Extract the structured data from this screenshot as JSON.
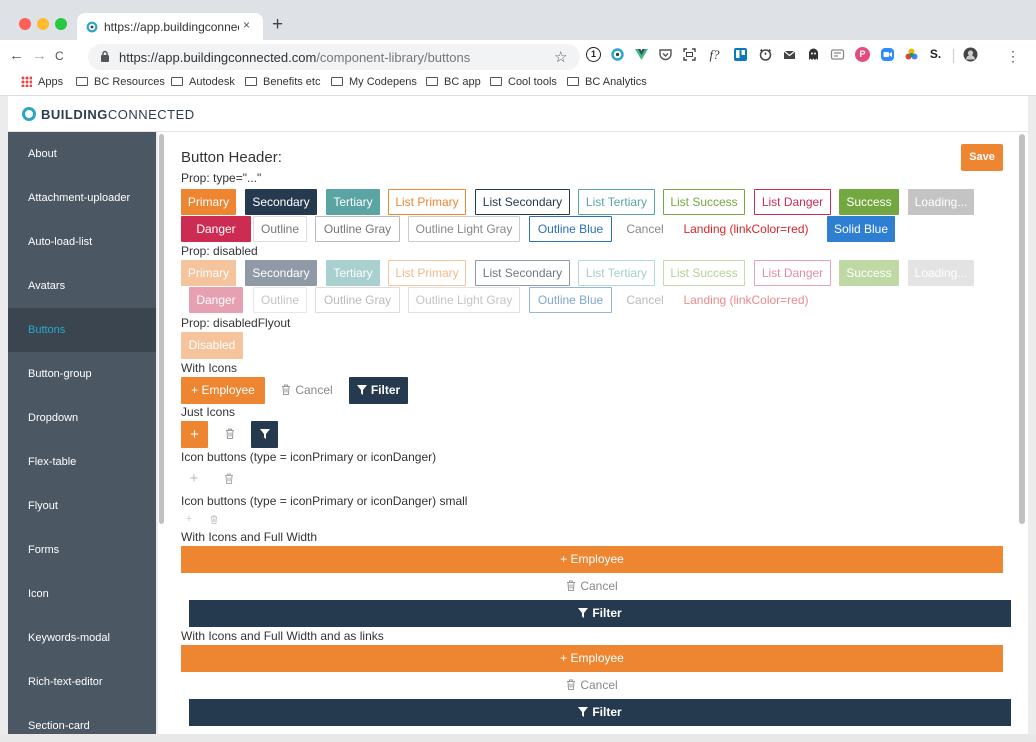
{
  "browser": {
    "tab_title": "https://app.buildingconnected",
    "tab_close": "×",
    "new_tab": "+",
    "back": "←",
    "forward": "→",
    "reload": "C",
    "url_scheme": "https://",
    "url_host": "app.buildingconnected.com",
    "url_path": "/component-library/buttons",
    "bookmarks": [
      "Apps",
      "BC Resources",
      "Autodesk",
      "Benefits etc",
      "My Codepens",
      "BC app",
      "Cool tools",
      "BC Analytics"
    ],
    "extension_profile_letter": "S."
  },
  "app": {
    "logo_bold": "BUILDING",
    "logo_light": "CONNECTED"
  },
  "sidebar": {
    "items": [
      {
        "label": "About"
      },
      {
        "label": "Attachment-uploader"
      },
      {
        "label": "Auto-load-list"
      },
      {
        "label": "Avatars"
      },
      {
        "label": "Buttons",
        "active": true
      },
      {
        "label": "Button-group"
      },
      {
        "label": "Dropdown"
      },
      {
        "label": "Flex-table"
      },
      {
        "label": "Flyout"
      },
      {
        "label": "Forms"
      },
      {
        "label": "Icon"
      },
      {
        "label": "Keywords-modal"
      },
      {
        "label": "Rich-text-editor"
      },
      {
        "label": "Section-card"
      }
    ]
  },
  "main": {
    "header": "Button Header:",
    "save": "Save",
    "prop_type": "Prop: type=\"...\"",
    "prop_disabled": "Prop: disabled",
    "prop_flyout": "Prop: disabledFlyout",
    "with_icons": "With Icons",
    "just_icons": "Just Icons",
    "icon_buttons": "Icon buttons (type = iconPrimary or iconDanger)",
    "icon_buttons_small": "Icon buttons (type = iconPrimary or iconDanger) small",
    "full_width": "With Icons and Full Width",
    "full_width_links": "With Icons and Full Width and as links",
    "buttons": {
      "primary": "Primary",
      "secondary": "Secondary",
      "tertiary": "Tertiary",
      "list_primary": "List Primary",
      "list_secondary": "List Secondary",
      "list_tertiary": "List Tertiary",
      "list_success": "List Success",
      "list_danger": "List Danger",
      "success": "Success",
      "loading": "Loading...",
      "danger": "Danger",
      "outline": "Outline",
      "outline_gray": "Outline Gray",
      "outline_light_gray": "Outline Light Gray",
      "outline_blue": "Outline Blue",
      "cancel": "Cancel",
      "landing": "Landing (linkColor=red)",
      "solid_blue": "Solid Blue",
      "disabled": "Disabled",
      "employee": "+ Employee",
      "filter": "Filter",
      "plus": "+"
    }
  },
  "colors": {
    "primary": "#ed8531",
    "secondary": "#263a4f",
    "tertiary": "#5aa5a3",
    "success": "#73a841",
    "danger": "#cc2b52",
    "blue": "#2d6fb8",
    "solid_blue": "#2e7fd1",
    "sidebar": "#4b5763",
    "active_link": "#28a9cf"
  }
}
